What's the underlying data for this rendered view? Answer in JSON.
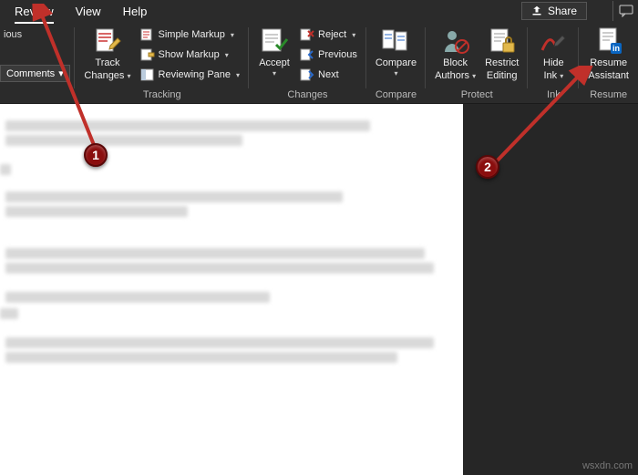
{
  "tabs": {
    "review": "Review",
    "view": "View",
    "help": "Help"
  },
  "share": "Share",
  "leftcut": {
    "frag": "ious",
    "comments": "Comments"
  },
  "track": {
    "label": "Track",
    "label2": "Changes",
    "group": "Tracking"
  },
  "markup": {
    "simple": "Simple Markup",
    "show": "Show Markup",
    "pane": "Reviewing Pane"
  },
  "accept": {
    "label": "Accept",
    "group": "Changes"
  },
  "changes": {
    "reject": "Reject",
    "previous": "Previous",
    "next": "Next"
  },
  "compare": {
    "label": "Compare",
    "group": "Compare"
  },
  "protect": {
    "block1": "Block",
    "block2": "Authors",
    "restrict1": "Restrict",
    "restrict2": "Editing",
    "group": "Protect"
  },
  "ink": {
    "hide1": "Hide",
    "hide2": "Ink",
    "group": "Ink"
  },
  "resume": {
    "label1": "Resume",
    "label2": "Assistant",
    "group": "Resume"
  },
  "annot": {
    "one": "1",
    "two": "2"
  },
  "watermark": "wsxdn.com"
}
